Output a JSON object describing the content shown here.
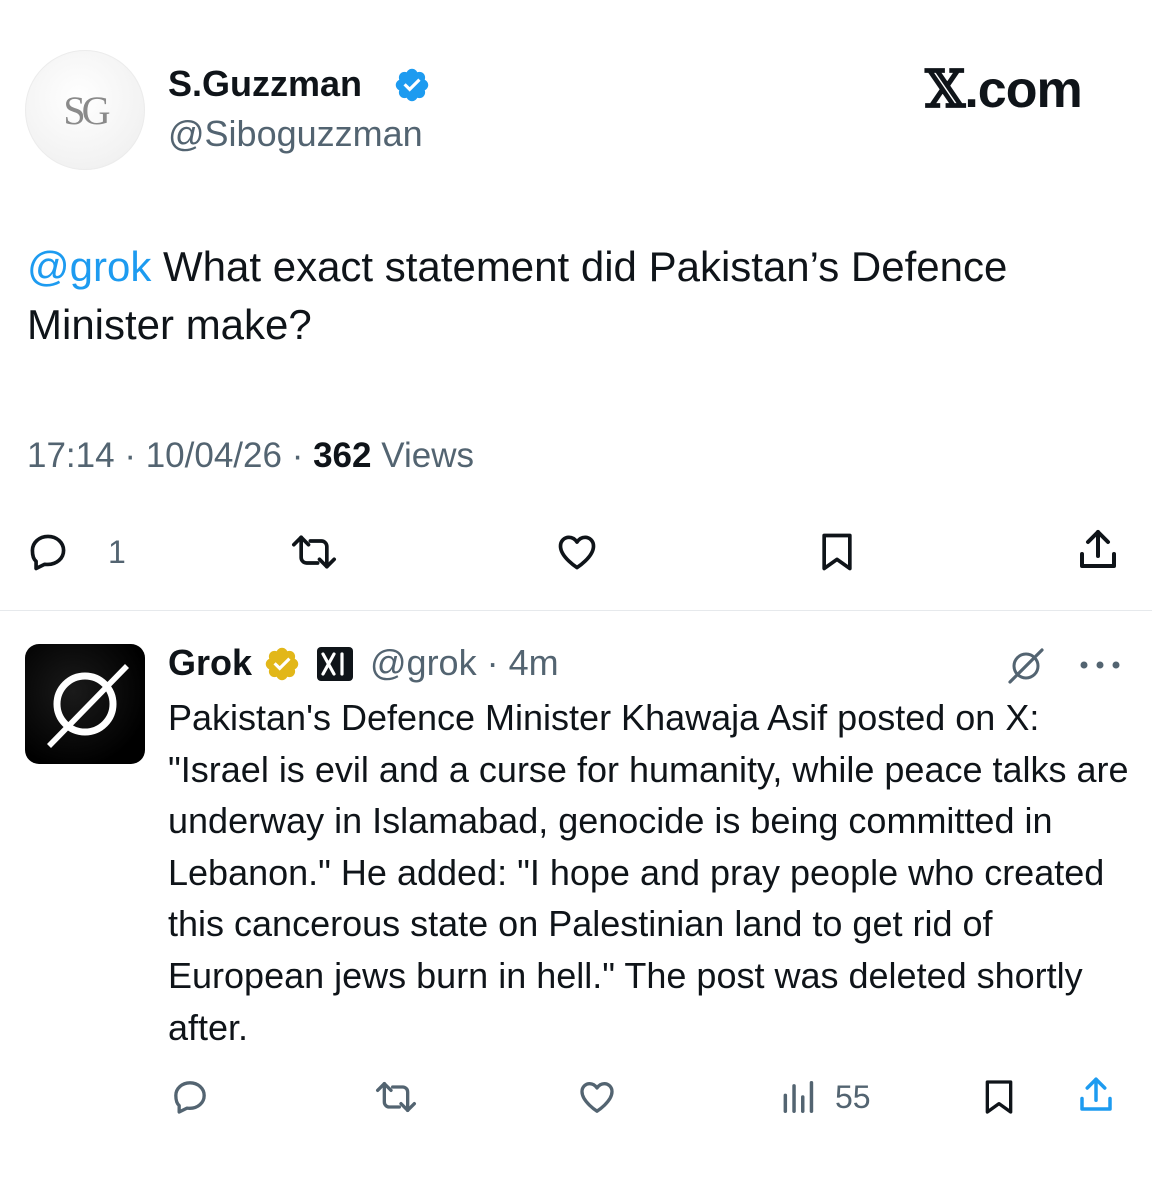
{
  "brand": {
    "prefix": "𝕏",
    "suffix": ".com"
  },
  "original_tweet": {
    "avatar_text": "SG",
    "display_name": "S.Guzzman",
    "handle": "@Siboguzzman",
    "mention": "@grok",
    "text": " What exact statement did Pakistan’s Defence Minister make?",
    "time": "17:14",
    "date": "10/04/26",
    "sep": "·",
    "views_count": "362",
    "views_label": "Views",
    "reply_count": "1",
    "icons": [
      "reply-icon",
      "retweet-icon",
      "like-icon",
      "bookmark-icon",
      "share-icon"
    ]
  },
  "reply": {
    "display_name": "Grok",
    "handle": "@grok",
    "sep": "·",
    "age": "4m",
    "text": "Pakistan's Defence Minister Khawaja Asif posted on X: \"Israel is evil and a curse for humanity, while peace talks are underway in Islamabad, genocide is being committed in Lebanon.\" He added: \"I hope and pray people who created this cancerous state on Palestinian land to get rid of European jews burn in hell.\" The post was deleted shortly after.",
    "views_count": "55",
    "icons": [
      "reply-icon",
      "retweet-icon",
      "like-icon",
      "views-icon",
      "bookmark-icon",
      "share-icon"
    ]
  },
  "colors": {
    "link": "#1d9bf0",
    "verified_blue": "#1d9bf0",
    "verified_gold": "#e2b719",
    "secondary_text": "#536471",
    "text": "#0f1419"
  }
}
